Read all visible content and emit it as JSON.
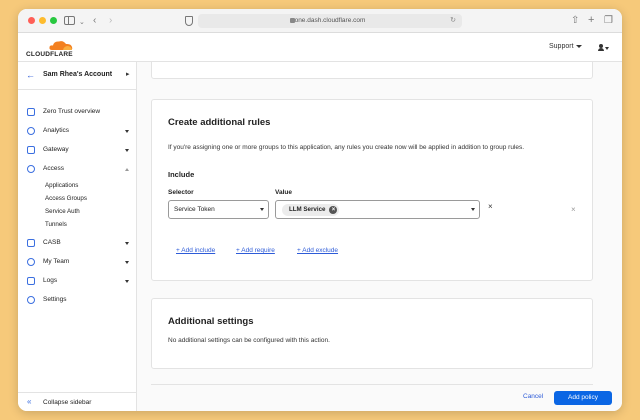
{
  "browser": {
    "url": "one.dash.cloudflare.com"
  },
  "header": {
    "logo_text": "CLOUDFLARE",
    "support_label": "Support",
    "brand_color": "#f38020"
  },
  "sidebar": {
    "account_name": "Sam Rhea's Account",
    "items": [
      {
        "label": "Zero Trust overview",
        "icon": "home-icon"
      },
      {
        "label": "Analytics",
        "icon": "analytics-icon"
      },
      {
        "label": "Gateway",
        "icon": "gateway-icon"
      },
      {
        "label": "Access",
        "icon": "access-icon"
      },
      {
        "label": "CASB",
        "icon": "casb-icon"
      },
      {
        "label": "My Team",
        "icon": "team-icon"
      },
      {
        "label": "Logs",
        "icon": "logs-icon"
      },
      {
        "label": "Settings",
        "icon": "gear-icon"
      }
    ],
    "access_subitems": [
      "Applications",
      "Access Groups",
      "Service Auth",
      "Tunnels"
    ],
    "collapse_label": "Collapse sidebar"
  },
  "rules": {
    "title": "Create additional rules",
    "description": "If you're assigning one or more groups to this application, any rules you create now will be applied in addition to group rules.",
    "include_label": "Include",
    "selector_label": "Selector",
    "value_label": "Value",
    "selector_value": "Service Token",
    "value_chip": "LLM Service",
    "add_include": "+ Add include",
    "add_require": "+ Add require",
    "add_exclude": "+ Add exclude"
  },
  "settings": {
    "title": "Additional settings",
    "description": "No additional settings can be configured with this action."
  },
  "footer": {
    "cancel_label": "Cancel",
    "add_policy_label": "Add policy"
  }
}
